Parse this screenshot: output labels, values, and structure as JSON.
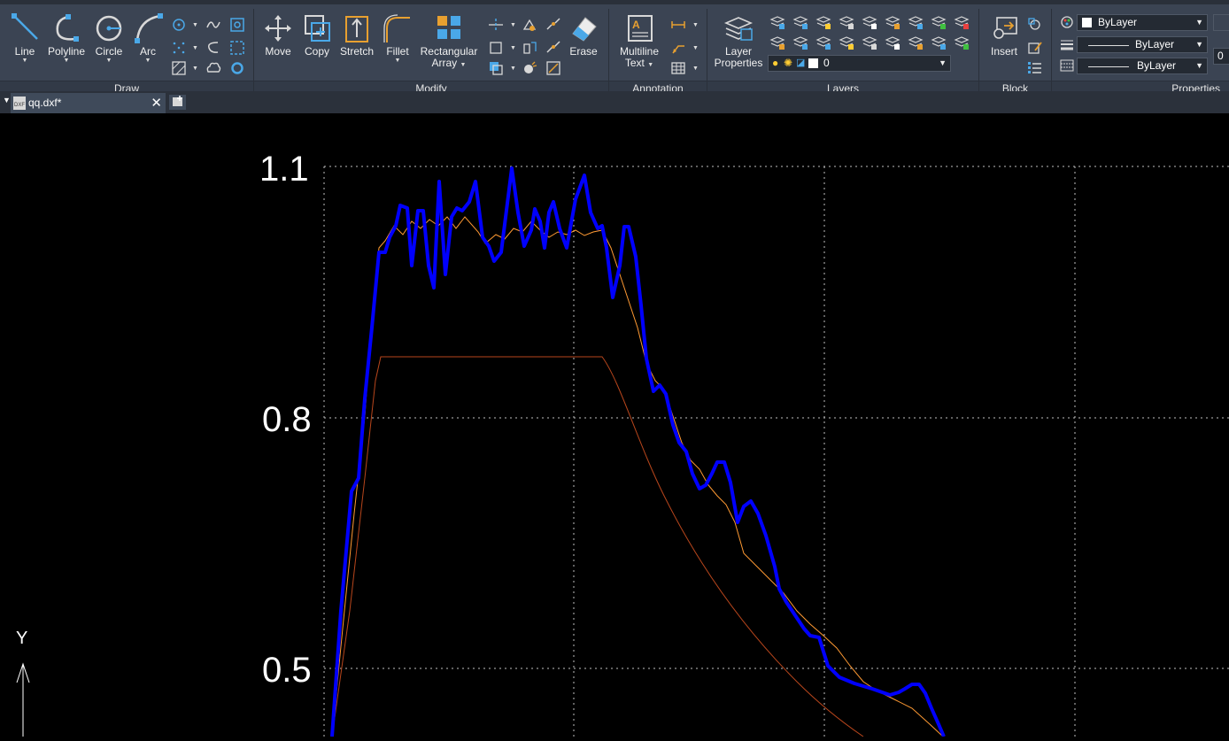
{
  "ribbon": {
    "draw": {
      "title": "Draw",
      "tools": [
        {
          "label": "Line",
          "icon": "line-icon"
        },
        {
          "label": "Polyline",
          "icon": "polyline-icon"
        },
        {
          "label": "Circle",
          "icon": "circle-icon"
        },
        {
          "label": "Arc",
          "icon": "arc-icon"
        }
      ]
    },
    "modify": {
      "title": "Modify",
      "tools": [
        {
          "label": "Move",
          "icon": "move-icon"
        },
        {
          "label": "Copy",
          "icon": "copy-icon"
        },
        {
          "label": "Stretch",
          "icon": "stretch-icon"
        },
        {
          "label": "Fillet",
          "icon": "fillet-icon"
        },
        {
          "label": "Rectangular",
          "label2": "Array",
          "icon": "rectangular-array-icon"
        },
        {
          "label": "Erase",
          "icon": "erase-icon"
        }
      ]
    },
    "annotation": {
      "title": "Annotation",
      "multiline": "Multiline",
      "multiline2": "Text"
    },
    "layers": {
      "title": "Layers",
      "layer_properties": "Layer",
      "layer_properties2": "Properties",
      "current_layer": "0"
    },
    "block": {
      "title": "Block",
      "insert": "Insert"
    },
    "properties": {
      "title": "Properties",
      "color": "ByLayer",
      "linetype": "ByLayer",
      "lineweight": "ByLayer",
      "transparency": "0"
    }
  },
  "tabs": {
    "active_file": "qq.dxf*"
  },
  "drawing": {
    "y_tick_labels": [
      "1.1",
      "0.8",
      "0.5"
    ],
    "ucs_axis_label": "Y"
  },
  "colors": {
    "ribbon_bg": "#3b4453",
    "accent_blue": "#4aa8e8",
    "series_blue": "#0000ff",
    "series_orange": "#ff9a33",
    "series_brown": "#b8461c",
    "grid": "#bfbfbf"
  }
}
